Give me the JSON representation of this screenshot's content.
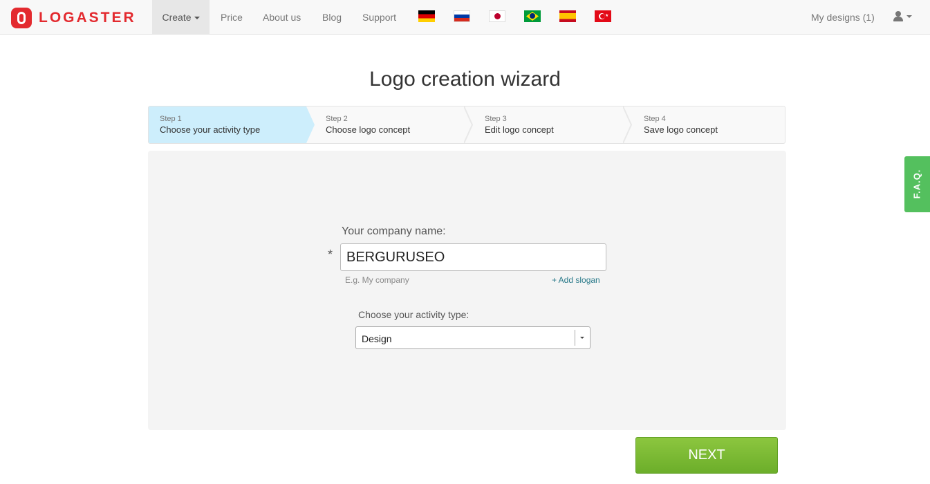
{
  "brand": {
    "name": "LOGASTER",
    "color": "#e32a2f"
  },
  "nav": {
    "items": [
      {
        "label": "Create",
        "active": true,
        "has_dropdown": true
      },
      {
        "label": "Price"
      },
      {
        "label": "About us"
      },
      {
        "label": "Blog"
      },
      {
        "label": "Support"
      }
    ],
    "languages": [
      "flag-germany",
      "flag-russia",
      "flag-japan",
      "flag-brazil",
      "flag-spain",
      "flag-turkey"
    ],
    "my_designs": "My designs (1)",
    "user_icon": "user-icon"
  },
  "page": {
    "title": "Logo creation wizard"
  },
  "steps": [
    {
      "number": "Step 1",
      "label": "Choose your activity type",
      "active": true
    },
    {
      "number": "Step 2",
      "label": "Choose logo concept"
    },
    {
      "number": "Step 3",
      "label": "Edit logo concept"
    },
    {
      "number": "Step 4",
      "label": "Save logo concept"
    }
  ],
  "form": {
    "company_label": "Your company name:",
    "required_mark": "*",
    "company_value": "BERGURUSEO",
    "hint": "E.g. My company",
    "add_slogan": "+ Add slogan",
    "activity_label": "Choose your activity type:",
    "activity_value": "Design"
  },
  "actions": {
    "next": "NEXT",
    "next_color": "#7cb934"
  },
  "faq": {
    "label": "F.A.Q.",
    "color": "#54c05e"
  }
}
